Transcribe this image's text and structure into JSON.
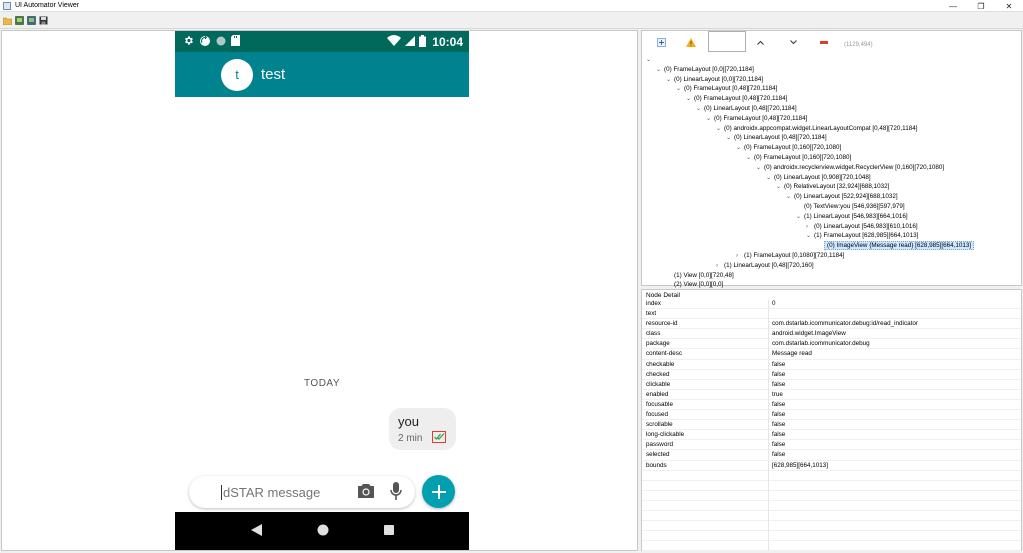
{
  "window": {
    "title": "UI Automator Viewer",
    "controls": [
      "—",
      "❐",
      "✕"
    ]
  },
  "phone": {
    "clock": "10:04",
    "contact_initial": "t",
    "contact_name": "test",
    "date_divider": "TODAY",
    "message": {
      "text": "you",
      "time": "2 min"
    },
    "composer_placeholder": "dSTAR message",
    "colors": {
      "status": "#00695c",
      "appbar": "#00838f",
      "fab": "#00a0b0"
    }
  },
  "hierarchy": {
    "coords": "(1129,494)",
    "rows": [
      {
        "indent": 0,
        "twisty": "⌄",
        "label": ""
      },
      {
        "indent": 1,
        "twisty": "⌄",
        "label": "(0) FrameLayout [0,0][720,1184]"
      },
      {
        "indent": 2,
        "twisty": "⌄",
        "label": "(0) LinearLayout [0,0][720,1184]"
      },
      {
        "indent": 3,
        "twisty": "⌄",
        "label": "(0) FrameLayout [0,48][720,1184]"
      },
      {
        "indent": 4,
        "twisty": "⌄",
        "label": "(0) FrameLayout [0,48][720,1184]"
      },
      {
        "indent": 5,
        "twisty": "⌄",
        "label": "(0) LinearLayout [0,48][720,1184]"
      },
      {
        "indent": 6,
        "twisty": "⌄",
        "label": "(0) FrameLayout [0,48][720,1184]"
      },
      {
        "indent": 7,
        "twisty": "⌄",
        "label": "(0) androidx.appcompat.widget.LinearLayoutCompat [0,48][720,1184]"
      },
      {
        "indent": 8,
        "twisty": "⌄",
        "label": "(0) LinearLayout [0,48][720,1184]"
      },
      {
        "indent": 9,
        "twisty": "⌄",
        "label": "(0) FrameLayout [0,160][720,1080]"
      },
      {
        "indent": 10,
        "twisty": "⌄",
        "label": "(0) FrameLayout [0,160][720,1080]"
      },
      {
        "indent": 11,
        "twisty": "⌄",
        "label": "(0) androidx.recyclerview.widget.RecyclerView [0,160][720,1080]"
      },
      {
        "indent": 12,
        "twisty": "⌄",
        "label": "(0) LinearLayout [0,908][720,1048]"
      },
      {
        "indent": 13,
        "twisty": "⌄",
        "label": "(0) RelativeLayout [32,924][688,1032]"
      },
      {
        "indent": 14,
        "twisty": "⌄",
        "label": "(0) LinearLayout [522,924][688,1032]"
      },
      {
        "indent": 15,
        "twisty": "",
        "label": "(0) TextView:you [546,936][597,979]"
      },
      {
        "indent": 15,
        "twisty": "⌄",
        "label": "(1) LinearLayout [546,983][664,1016]"
      },
      {
        "indent": 16,
        "twisty": "›",
        "label": "(0) LinearLayout [546,983][610,1016]"
      },
      {
        "indent": 16,
        "twisty": "⌄",
        "label": "(1) FrameLayout [628,985][664,1013]"
      },
      {
        "indent": 17,
        "twisty": "",
        "label": "(0) ImageView {Message read} [628,985][664,1013]",
        "selected": true
      },
      {
        "indent": 9,
        "twisty": "›",
        "label": "(1) FrameLayout [0,1080][720,1184]"
      },
      {
        "indent": 7,
        "twisty": "›",
        "label": "(1) LinearLayout [0,48][720,160]"
      },
      {
        "indent": 2,
        "twisty": "",
        "label": "(1) View [0,0][720,48]"
      },
      {
        "indent": 2,
        "twisty": "",
        "label": "(2) View [0,0][0,0]"
      }
    ]
  },
  "node_detail": {
    "title": "Node Detail",
    "props": [
      {
        "k": "index",
        "v": "0"
      },
      {
        "k": "text",
        "v": ""
      },
      {
        "k": "resource-id",
        "v": "com.dstarlab.icommunicator.debug:id/read_indicator"
      },
      {
        "k": "class",
        "v": "android.widget.ImageView"
      },
      {
        "k": "package",
        "v": "com.dstarlab.icommunicator.debug"
      },
      {
        "k": "content-desc",
        "v": "Message read"
      },
      {
        "k": "checkable",
        "v": "false"
      },
      {
        "k": "checked",
        "v": "false"
      },
      {
        "k": "clickable",
        "v": "false"
      },
      {
        "k": "enabled",
        "v": "true"
      },
      {
        "k": "focusable",
        "v": "false"
      },
      {
        "k": "focused",
        "v": "false"
      },
      {
        "k": "scrollable",
        "v": "false"
      },
      {
        "k": "long-clickable",
        "v": "false"
      },
      {
        "k": "password",
        "v": "false"
      },
      {
        "k": "selected",
        "v": "false"
      },
      {
        "k": "bounds",
        "v": "[628,985][664,1013]"
      },
      {
        "k": "",
        "v": ""
      },
      {
        "k": "",
        "v": ""
      },
      {
        "k": "",
        "v": ""
      },
      {
        "k": "",
        "v": ""
      },
      {
        "k": "",
        "v": ""
      },
      {
        "k": "",
        "v": ""
      },
      {
        "k": "",
        "v": ""
      },
      {
        "k": "",
        "v": ""
      }
    ]
  }
}
